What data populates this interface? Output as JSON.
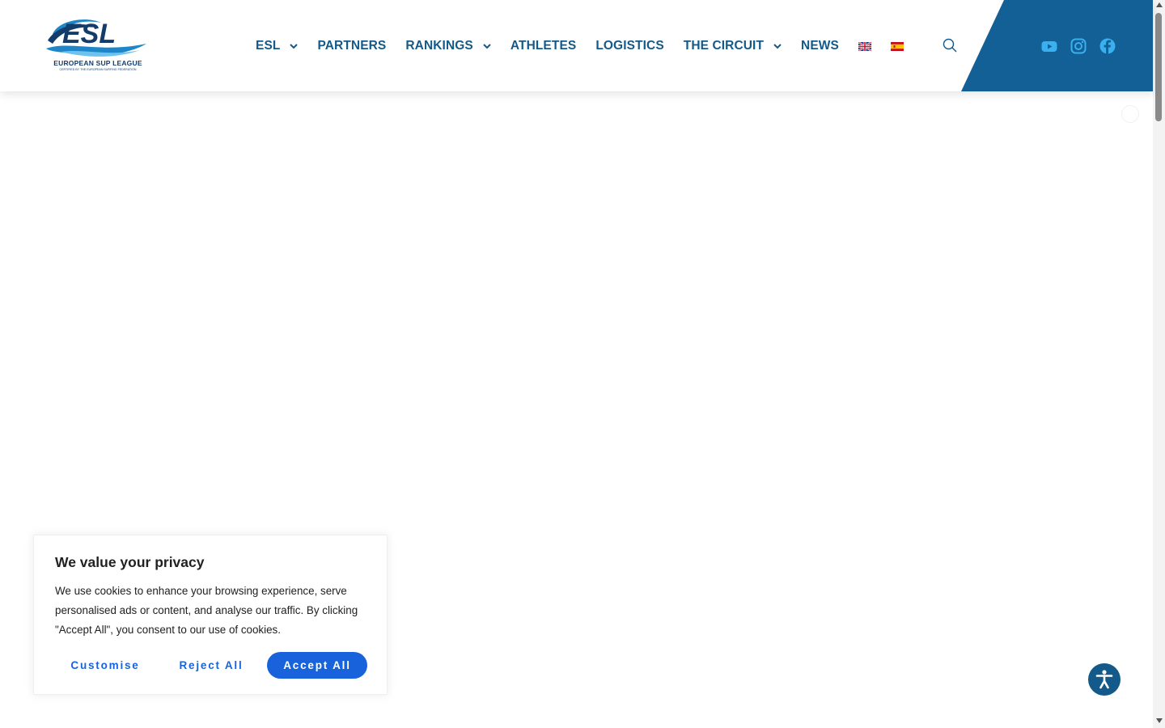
{
  "header": {
    "logo": {
      "wordmark": "ESL",
      "caption": "EUROPEAN SUP LEAGUE",
      "subcaption": "CERTIFIED BY THE EUROPEAN SURFING FEDERATION"
    },
    "nav": [
      {
        "label": "ESL",
        "has_dropdown": true
      },
      {
        "label": "PARTNERS",
        "has_dropdown": false
      },
      {
        "label": "RANKINGS",
        "has_dropdown": true
      },
      {
        "label": "ATHLETES",
        "has_dropdown": false
      },
      {
        "label": "LOGISTICS",
        "has_dropdown": false
      },
      {
        "label": "THE CIRCUIT",
        "has_dropdown": true
      },
      {
        "label": "NEWS",
        "has_dropdown": false
      }
    ],
    "languages": [
      {
        "icon": "uk-flag-icon"
      },
      {
        "icon": "spain-flag-icon"
      }
    ],
    "search_icon": "search-icon",
    "social": [
      {
        "icon": "youtube-icon"
      },
      {
        "icon": "instagram-icon"
      },
      {
        "icon": "facebook-icon"
      }
    ]
  },
  "cookie_banner": {
    "title": "We value your privacy",
    "text": "We use cookies to enhance your browsing experience, serve personalised ads or content, and analyse our traffic. By clicking \"Accept All\", you consent to our use of cookies.",
    "customise_label": "Customise",
    "reject_label": "Reject All",
    "accept_label": "Accept All"
  },
  "accessibility_icon": "accessibility-icon",
  "colors": {
    "brand_blue": "#135a8a",
    "panel_blue": "#136096",
    "cookie_accent": "#1863dc",
    "text_dark": "#212121"
  }
}
